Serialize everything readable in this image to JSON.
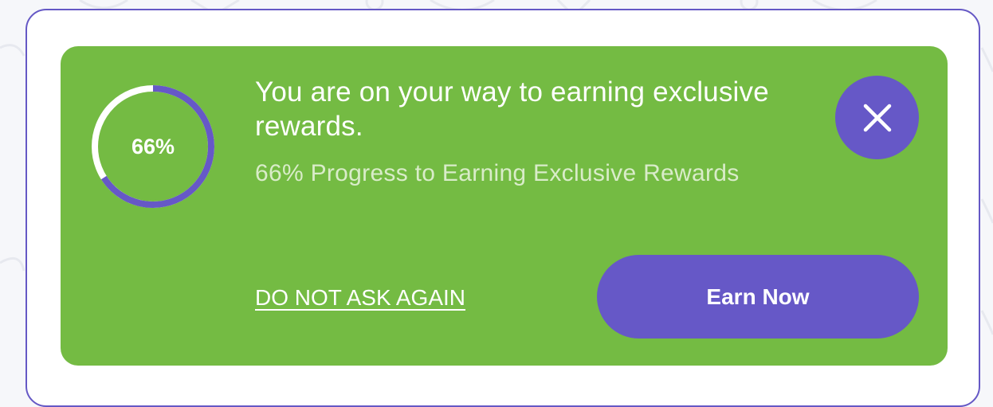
{
  "banner": {
    "progress": {
      "value_percent": 66,
      "label": "66%"
    },
    "headline": "You are on your way to earning exclusive rewards.",
    "subline": "66% Progress to Earning Exclusive Rewards",
    "dismiss_label": "DO NOT ASK AGAIN",
    "cta_label": "Earn Now",
    "close_icon": "close-icon"
  },
  "colors": {
    "banner_green": "#74bb43",
    "accent_purple": "#6658c7",
    "ring_track": "#ffffff",
    "subtext": "#d9ecc9"
  }
}
